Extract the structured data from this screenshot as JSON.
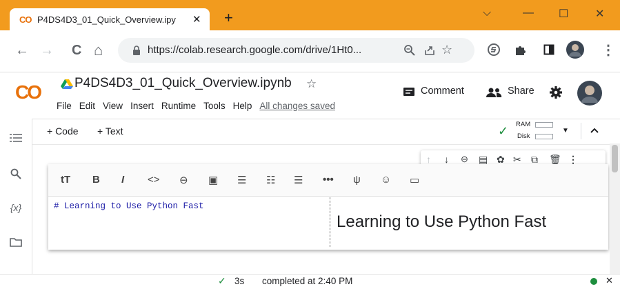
{
  "browser": {
    "tab_title": "P4DS4D3_01_Quick_Overview.ipy",
    "tab_logo": "CO",
    "tab_close": "✕",
    "new_tab": "+",
    "window_controls": {
      "chevron": "⌵",
      "minimize": "—",
      "maximize": "☐",
      "close": "✕"
    },
    "nav": {
      "back": "←",
      "forward": "→",
      "reload": "C",
      "home": "⌂"
    },
    "url": "https://colab.research.google.com/drive/1Ht0...",
    "accent_color": "#f29b1e"
  },
  "colab": {
    "logo": "CO",
    "notebook_title": "P4DS4D3_01_Quick_Overview.ipynb",
    "menu": [
      "File",
      "Edit",
      "View",
      "Insert",
      "Runtime",
      "Tools",
      "Help"
    ],
    "save_status": "All changes saved",
    "comment_label": "Comment",
    "share_label": "Share"
  },
  "toolbar": {
    "add_code": "+ Code",
    "add_text": "+ Text",
    "ram_label": "RAM",
    "disk_label": "Disk"
  },
  "left_rail": {
    "icons": [
      "table-of-contents-icon",
      "search-icon",
      "variables-icon",
      "files-icon"
    ],
    "variables_glyph": "{x}"
  },
  "cell": {
    "format_buttons": [
      "tT",
      "B",
      "I",
      "<>",
      "link",
      "image",
      "indent",
      "numbered-list",
      "bulleted-list",
      "hr",
      "ψ",
      "☺",
      "terminal"
    ],
    "source": "# Learning to Use Python Fast",
    "rendered": "Learning to Use Python Fast"
  },
  "status": {
    "check": "✓",
    "duration": "3s",
    "completed_text": "completed at 2:40 PM",
    "dot_color": "#1e8e3e"
  }
}
